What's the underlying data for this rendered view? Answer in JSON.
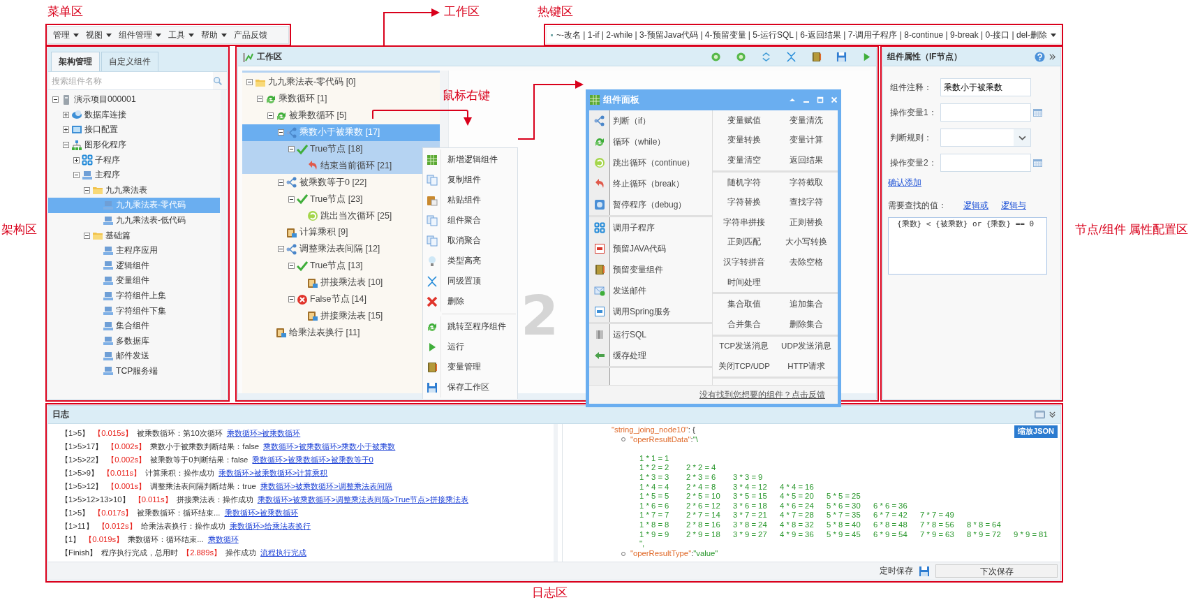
{
  "annotations": {
    "menu": "菜单区",
    "work": "工作区",
    "hotkey": "热键区",
    "tree": "架构区",
    "right_click": "鼠标右键",
    "props": "节点/组件 属性配置区",
    "log": "日志区"
  },
  "menu_bar": [
    {
      "label": "管理",
      "dropdown": true
    },
    {
      "label": "视图",
      "dropdown": true
    },
    {
      "label": "组件管理",
      "dropdown": true
    },
    {
      "label": "工具",
      "dropdown": true
    },
    {
      "label": "帮助",
      "dropdown": true
    },
    {
      "label": "产品反馈",
      "dropdown": false
    }
  ],
  "hotkeys": "~-改名 | 1-if | 2-while | 3-预留Java代码 | 4-预留变量 | 5-运行SQL | 6-返回结果 | 7-调用子程序 | 8-continue | 9-break | 0-接口 | del-删除",
  "tree_panel": {
    "tabs": [
      {
        "label": "架构管理",
        "selected": true
      },
      {
        "label": "自定义组件",
        "selected": false
      }
    ],
    "search": {
      "placeholder": "搜索组件名称"
    },
    "tree": [
      {
        "label": "演示项目000001",
        "kind": "server",
        "expanded": true,
        "selected": false,
        "children": [
          {
            "label": "数据库连接",
            "kind": "db",
            "expanded": false,
            "selected": false
          },
          {
            "label": "接口配置",
            "kind": "api",
            "expanded": false,
            "selected": false
          },
          {
            "label": "图形化程序",
            "kind": "org",
            "expanded": true,
            "selected": false,
            "children": [
              {
                "label": "子程序",
                "kind": "subprog",
                "expanded": false,
                "selected": false
              },
              {
                "label": "主程序",
                "kind": "program",
                "expanded": true,
                "selected": false,
                "children": [
                  {
                    "label": "九九乘法表",
                    "kind": "folder",
                    "expanded": true,
                    "selected": false,
                    "children": [
                      {
                        "label": "九九乘法表-零代码",
                        "kind": "page",
                        "selected": true
                      },
                      {
                        "label": "九九乘法表-低代码",
                        "kind": "page",
                        "selected": false
                      }
                    ]
                  },
                  {
                    "label": "基础篇",
                    "kind": "folder",
                    "expanded": true,
                    "selected": false,
                    "children": [
                      {
                        "label": "主程序应用",
                        "kind": "page",
                        "selected": false
                      },
                      {
                        "label": "逻辑组件",
                        "kind": "page",
                        "selected": false
                      },
                      {
                        "label": "变量组件",
                        "kind": "page",
                        "selected": false
                      },
                      {
                        "label": "字符组件上集",
                        "kind": "page",
                        "selected": false
                      },
                      {
                        "label": "字符组件下集",
                        "kind": "page",
                        "selected": false
                      },
                      {
                        "label": "集合组件",
                        "kind": "page",
                        "selected": false
                      },
                      {
                        "label": "多数据库",
                        "kind": "page",
                        "selected": false
                      },
                      {
                        "label": "邮件发送",
                        "kind": "page",
                        "selected": false
                      },
                      {
                        "label": "TCP服务端",
                        "kind": "page",
                        "selected": false
                      }
                    ]
                  }
                ]
              }
            ]
          }
        ]
      }
    ]
  },
  "work_area": {
    "title": "工作区",
    "canvas_number": "2",
    "flow": [
      {
        "label": "九九乘法表-零代码 [0]",
        "kind": "folder",
        "expanded": true,
        "selected": false,
        "highlighted": false,
        "children": [
          {
            "label": "乘数循环 [1]",
            "kind": "loop",
            "expanded": true,
            "selected": false,
            "highlighted": false,
            "children": [
              {
                "label": "被乘数循环 [5]",
                "kind": "loop",
                "expanded": true,
                "selected": false,
                "highlighted": false,
                "children": [
                  {
                    "label": "乘数小于被乘数 [17]",
                    "kind": "branch",
                    "expanded": true,
                    "selected": true,
                    "highlighted": true,
                    "children": [
                      {
                        "label": "True节点 [18]",
                        "kind": "true",
                        "expanded": true,
                        "selected": false,
                        "highlighted": true,
                        "children": [
                          {
                            "label": "结束当前循环 [21]",
                            "kind": "break",
                            "selected": false,
                            "highlighted": true
                          }
                        ]
                      }
                    ]
                  },
                  {
                    "label": "被乘数等于0 [22]",
                    "kind": "branch",
                    "expanded": true,
                    "selected": false,
                    "highlighted": false,
                    "children": [
                      {
                        "label": "True节点 [23]",
                        "kind": "true",
                        "expanded": true,
                        "selected": false,
                        "highlighted": false,
                        "children": [
                          {
                            "label": "跳出当次循环 [25]",
                            "kind": "continue",
                            "selected": false,
                            "highlighted": false
                          }
                        ]
                      }
                    ]
                  },
                  {
                    "label": "计算乘积 [9]",
                    "kind": "task",
                    "selected": false,
                    "highlighted": false
                  },
                  {
                    "label": "调整乘法表间隔 [12]",
                    "kind": "branch",
                    "expanded": true,
                    "selected": false,
                    "highlighted": false,
                    "children": [
                      {
                        "label": "True节点 [13]",
                        "kind": "true",
                        "expanded": true,
                        "selected": false,
                        "highlighted": false,
                        "children": [
                          {
                            "label": "拼接乘法表 [10]",
                            "kind": "task",
                            "selected": false,
                            "highlighted": false
                          }
                        ]
                      },
                      {
                        "label": "False节点 [14]",
                        "kind": "false",
                        "expanded": true,
                        "selected": false,
                        "highlighted": false,
                        "children": [
                          {
                            "label": "拼接乘法表 [15]",
                            "kind": "task",
                            "selected": false,
                            "highlighted": false
                          }
                        ]
                      }
                    ]
                  }
                ]
              },
              {
                "label": "给乘法表换行 [11]",
                "kind": "task",
                "selected": false,
                "highlighted": false
              }
            ]
          }
        ]
      }
    ],
    "context_menu": [
      [
        {
          "label": "新增逻辑组件",
          "kind": "add"
        },
        {
          "label": "复制组件",
          "kind": "copy"
        },
        {
          "label": "粘贴组件",
          "kind": "paste"
        },
        {
          "label": "组件聚合",
          "kind": "copy"
        },
        {
          "label": "取消聚合",
          "kind": "copy"
        },
        {
          "label": "类型高亮",
          "kind": "bulb"
        },
        {
          "label": "同级置顶",
          "kind": "arrows"
        },
        {
          "label": "删除",
          "kind": "delete"
        }
      ],
      [
        {
          "label": "跳转至程序组件",
          "kind": "loop"
        },
        {
          "label": "运行",
          "kind": "run"
        },
        {
          "label": "变量管理",
          "kind": "book"
        },
        {
          "label": "保存工作区",
          "kind": "save"
        }
      ]
    ]
  },
  "component_panel": {
    "title": "组件面板",
    "left_groups": [
      [
        {
          "label": "判断（if）",
          "kind": "branch"
        },
        {
          "label": "循环（while）",
          "kind": "loop"
        },
        {
          "label": "跳出循环（continue）",
          "kind": "continue"
        },
        {
          "label": "终止循环（break）",
          "kind": "break"
        },
        {
          "label": "暂停程序（debug）",
          "kind": "debug"
        }
      ],
      [
        {
          "label": "调用子程序",
          "kind": "subprog"
        },
        {
          "label": "预留JAVA代码",
          "kind": "java"
        },
        {
          "label": "预留变量组件",
          "kind": "book"
        },
        {
          "label": "发送邮件",
          "kind": "mail"
        },
        {
          "label": "调用Spring服务",
          "kind": "spring"
        }
      ],
      [
        {
          "label": "运行SQL",
          "kind": "sql"
        },
        {
          "label": "缓存处理",
          "kind": "cache"
        }
      ]
    ],
    "right_groups": [
      [
        "变量赋值",
        "变量清洗",
        "变量转换",
        "变量计算",
        "变量清空",
        "返回结果"
      ],
      [
        "随机字符",
        "字符截取",
        "字符替换",
        "查找字符",
        "字符串拼接",
        "正则替换",
        "正则匹配",
        "大小写转换",
        "汉字转拼音",
        "去除空格",
        "时间处理"
      ],
      [
        "集合取值",
        "追加集合",
        "合并集合",
        "删除集合"
      ],
      [
        "TCP发送消息",
        "UDP发送消息",
        "关闭TCP/UDP",
        "HTTP请求"
      ]
    ],
    "feedback_link": "没有找到您想要的组件？点击反馈"
  },
  "properties": {
    "title": "组件属性（IF节点）",
    "fields": [
      {
        "label": "组件注释：",
        "kind": "text",
        "value": "乘数小于被乘数"
      },
      {
        "label": "操作变量1：",
        "kind": "picker"
      },
      {
        "label": "判断规则：",
        "kind": "select"
      },
      {
        "label": "操作变量2：",
        "kind": "picker"
      }
    ],
    "confirm_link": "确认添加",
    "search_label": "需要查找的值：",
    "logic_links": [
      "逻辑或",
      "逻辑与"
    ],
    "expression": "{乘数} < {被乘数} or {乘数} == 0"
  },
  "log": {
    "title": "日志",
    "entries": [
      {
        "path": "【1>5】",
        "time": "【0.015s】",
        "message": "被乘数循环：第10次循环",
        "link": "乘数循环>被乘数循环"
      },
      {
        "path": "【1>5>17】",
        "time": "【0.002s】",
        "message": "乘数小于被乘数判断结果：false",
        "link": "乘数循环>被乘数循环>乘数小于被乘数"
      },
      {
        "path": "【1>5>22】",
        "time": "【0.002s】",
        "message": "被乘数等于0判断结果：false",
        "link": "乘数循环>被乘数循环>被乘数等于0"
      },
      {
        "path": "【1>5>9】",
        "time": "【0.011s】",
        "message": "计算乘积：操作成功",
        "link": "乘数循环>被乘数循环>计算乘积"
      },
      {
        "path": "【1>5>12】",
        "time": "【0.001s】",
        "message": "调整乘法表间隔判断结果：true",
        "link": "乘数循环>被乘数循环>调整乘法表间隔"
      },
      {
        "path": "【1>5>12>13>10】",
        "time": "【0.011s】",
        "message": "拼接乘法表：操作成功",
        "link": "乘数循环>被乘数循环>调整乘法表间隔>True节点>拼接乘法表"
      },
      {
        "path": "【1>5】",
        "time": "【0.017s】",
        "message": "被乘数循环：循环结束...",
        "link": "乘数循环>被乘数循环"
      },
      {
        "path": "【1>11】",
        "time": "【0.012s】",
        "message": "给乘法表换行：操作成功",
        "link": "乘数循环>给乘法表换行"
      },
      {
        "path": "【1】",
        "time": "【0.019s】",
        "message": "乘数循环：循环结束...",
        "link": "乘数循环"
      },
      {
        "path": "【Finish】",
        "pre": "程序执行完成，总用时",
        "time": "【2.889s】",
        "message": "操作成功",
        "link": "流程执行完成"
      }
    ],
    "json_view": {
      "button": "缩放JSON",
      "head_key": "\"string_joing_node10\"",
      "head_rest": ": {",
      "data_key": "\"operResultData\"",
      "data_sep": ":",
      "data_value": "\"\\",
      "table": [
        [
          "1 * 1 = 1"
        ],
        [
          "1 * 2 = 2",
          "2 * 2 = 4"
        ],
        [
          "1 * 3 = 3",
          "2 * 3 = 6",
          "3 * 3 = 9"
        ],
        [
          "1 * 4 = 4",
          "2 * 4 = 8",
          "3 * 4 = 12",
          "4 * 4 = 16"
        ],
        [
          "1 * 5 = 5",
          "2 * 5 = 10",
          "3 * 5 = 15",
          "4 * 5 = 20",
          "5 * 5 = 25"
        ],
        [
          "1 * 6 = 6",
          "2 * 6 = 12",
          "3 * 6 = 18",
          "4 * 6 = 24",
          "5 * 6 = 30",
          "6 * 6 = 36"
        ],
        [
          "1 * 7 = 7",
          "2 * 7 = 14",
          "3 * 7 = 21",
          "4 * 7 = 28",
          "5 * 7 = 35",
          "6 * 7 = 42",
          "7 * 7 = 49"
        ],
        [
          "1 * 8 = 8",
          "2 * 8 = 16",
          "3 * 8 = 24",
          "4 * 8 = 32",
          "5 * 8 = 40",
          "6 * 8 = 48",
          "7 * 8 = 56",
          "8 * 8 = 64"
        ],
        [
          "1 * 9 = 9",
          "2 * 9 = 18",
          "3 * 9 = 27",
          "4 * 9 = 36",
          "5 * 9 = 45",
          "6 * 9 = 54",
          "7 * 9 = 63",
          "8 * 9 = 72",
          "9 * 9 = 81"
        ]
      ],
      "data_close": "\",",
      "type_key": "\"operResultType\"",
      "type_sep": ":",
      "type_value": "\"value\""
    },
    "autosave_label": "定时保存",
    "next_save_button": "下次保存"
  }
}
